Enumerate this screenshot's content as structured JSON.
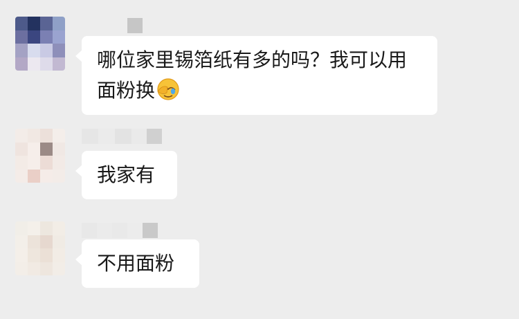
{
  "messages": [
    {
      "sender": "",
      "text": "哪位家里锡箔纸有多的吗？我可以用面粉换",
      "emoji_icon": "face-with-tears-covering-eyes-icon",
      "avatar_colors": [
        "#4d5a8a",
        "#23325f",
        "#5a6494",
        "#8fa0c7",
        "#6c6fa0",
        "#3b4680",
        "#7b80b3",
        "#9aa3d0",
        "#a4a2c4",
        "#d8dcee",
        "#c9cae4",
        "#8e8fba",
        "#b3a8c6",
        "#ece8f0",
        "#dedbea",
        "#c2b9d2"
      ]
    },
    {
      "sender": "",
      "text": "我家有",
      "avatar_colors": [
        "#f3ece8",
        "#f1e8e3",
        "#ece0da",
        "#f4eeea",
        "#efe4df",
        "#f6eeea",
        "#9b8a86",
        "#f0e8e4",
        "#f3ebe6",
        "#f6eeea",
        "#ecdcd6",
        "#f2eae6",
        "#f4ece8",
        "#eacfc7",
        "#f5ece8",
        "#f3ece8"
      ]
    },
    {
      "sender": "",
      "text": "不用面粉",
      "avatar_colors": [
        "#f1eee8",
        "#f4f0ea",
        "#ede7df",
        "#f2ede6",
        "#f3efe9",
        "#ece3da",
        "#e6d8cf",
        "#f0ebe4",
        "#f4efe9",
        "#eee6dd",
        "#ebe0d6",
        "#f2ece5",
        "#f3eee8",
        "#f1eae3",
        "#eee6de",
        "#f2ede7"
      ]
    }
  ],
  "colors": {
    "background": "#ededed",
    "bubble": "#ffffff",
    "text": "#191919"
  }
}
